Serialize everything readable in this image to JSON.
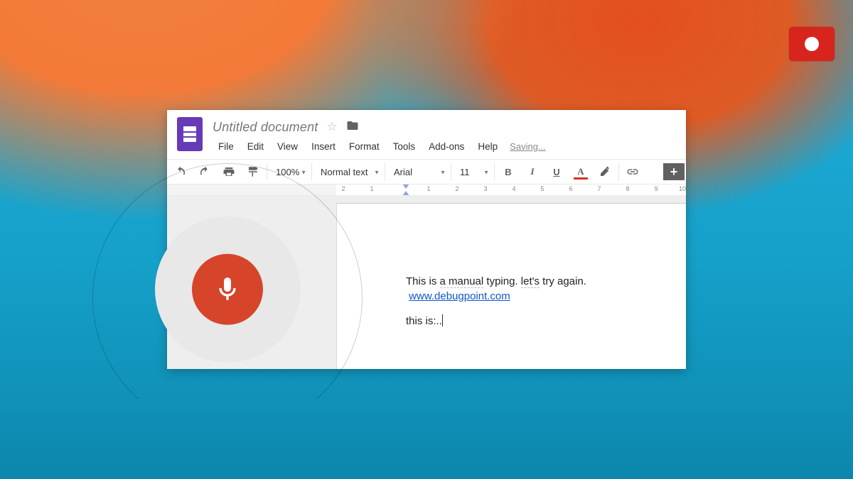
{
  "indicator": {
    "name": "record"
  },
  "docs": {
    "title": "Untitled document",
    "menu": [
      "File",
      "Edit",
      "View",
      "Insert",
      "Format",
      "Tools",
      "Add-ons",
      "Help"
    ],
    "status": "Saving...",
    "toolbar": {
      "zoom": "100%",
      "style": "Normal text",
      "font": "Arial",
      "size": "11",
      "buttons": {
        "undo": "undo",
        "redo": "redo",
        "print": "print",
        "paint": "paint-format",
        "bold": "B",
        "italic": "I",
        "underline": "U",
        "textcolor": "A",
        "highlight": "highlight",
        "link": "link",
        "more": "+"
      }
    },
    "ruler": {
      "marks": [
        "2",
        "1",
        "1",
        "2",
        "3",
        "4",
        "5",
        "6",
        "7",
        "8",
        "9",
        "10"
      ]
    },
    "body": {
      "line1_a": "This is ",
      "line1_b": "a manual",
      "line1_c": " typing.  ",
      "line1_d": "let's",
      "line1_e": " try again.",
      "link": "www.debugpoint.com",
      "line3": "this is:.."
    }
  },
  "voice": {
    "state": "listening"
  }
}
